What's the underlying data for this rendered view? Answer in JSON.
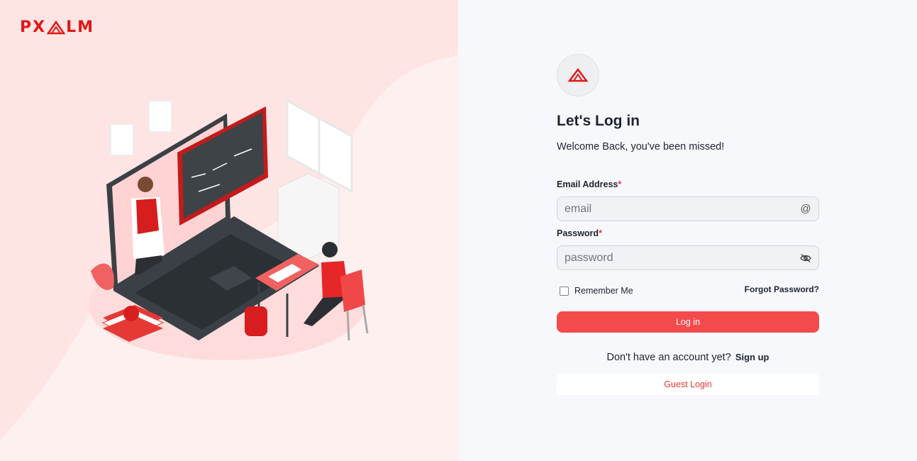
{
  "brand": {
    "left": "PX",
    "right": "LM",
    "color": "#e01818"
  },
  "login": {
    "title": "Let's Log in",
    "subtitle": "Welcome Back, you've been missed!",
    "email_label": "Email Address",
    "email_placeholder": "email",
    "email_icon": "at-icon",
    "password_label": "Password",
    "password_placeholder": "password",
    "password_icon": "eye-off-icon",
    "required_mark": "*",
    "remember_label": "Remember Me",
    "remember_checked": false,
    "forgot_label": "Forgot Password?",
    "login_button": "Log in",
    "signup_prompt": "Don't have an account yet?",
    "signup_link": "Sign up",
    "guest_button": "Guest Login"
  },
  "colors": {
    "accent": "#f34b4b",
    "left_panel_bg": "#ffe4e4",
    "right_panel_bg": "#f7f8fb",
    "text": "#1d2433"
  }
}
